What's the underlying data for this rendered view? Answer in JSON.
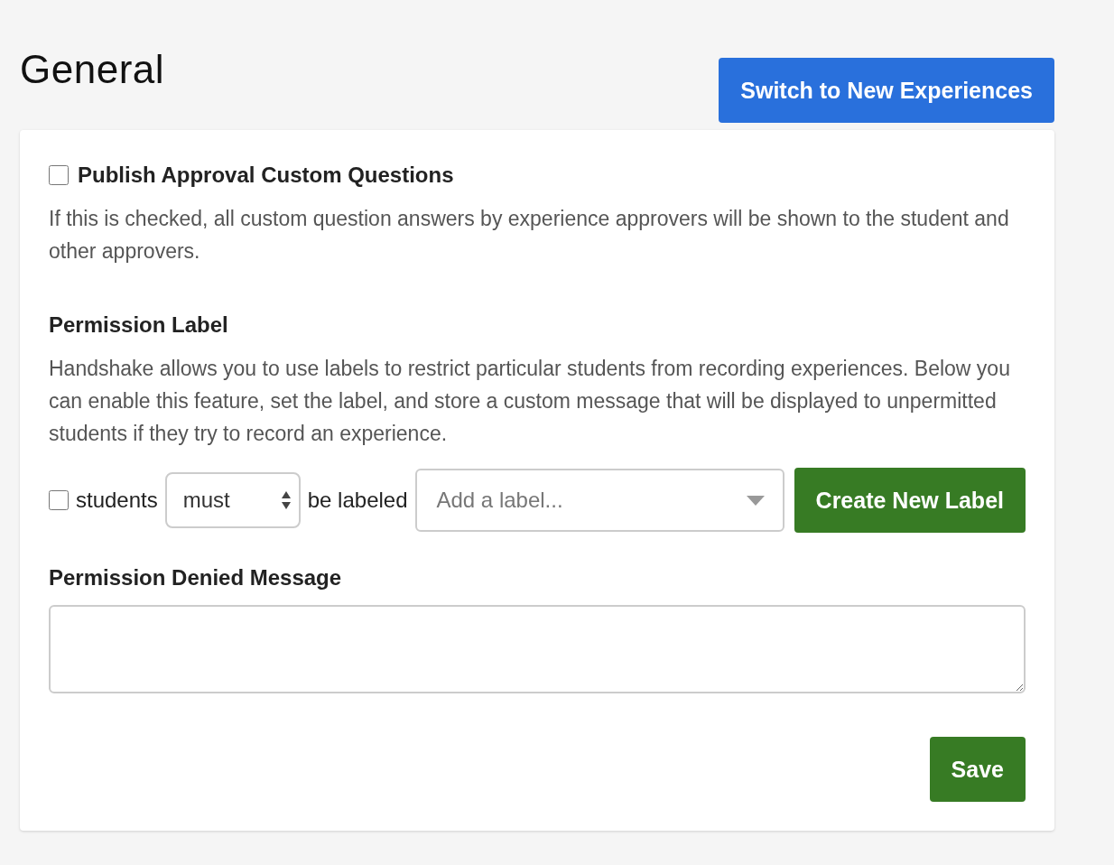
{
  "page": {
    "title": "General"
  },
  "switch_button": {
    "label": "Switch to New Experiences"
  },
  "publish": {
    "label": "Publish Approval Custom Questions",
    "checked": false,
    "description": "If this is checked, all custom question answers by experience approvers will be shown to the student and other approvers."
  },
  "permission_label": {
    "heading": "Permission Label",
    "description": "Handshake allows you to use labels to restrict particular students from recording experiences. Below you can enable this feature, set the label, and store a custom message that will be displayed to unpermitted students if they try to record an experience.",
    "enabled": false,
    "subject": "students",
    "rule": "must",
    "connector": "be labeled",
    "label_placeholder": "Add a label...",
    "create_button": "Create New Label"
  },
  "denied_message": {
    "label": "Permission Denied Message"
  },
  "save_button": {
    "label": "Save"
  }
}
